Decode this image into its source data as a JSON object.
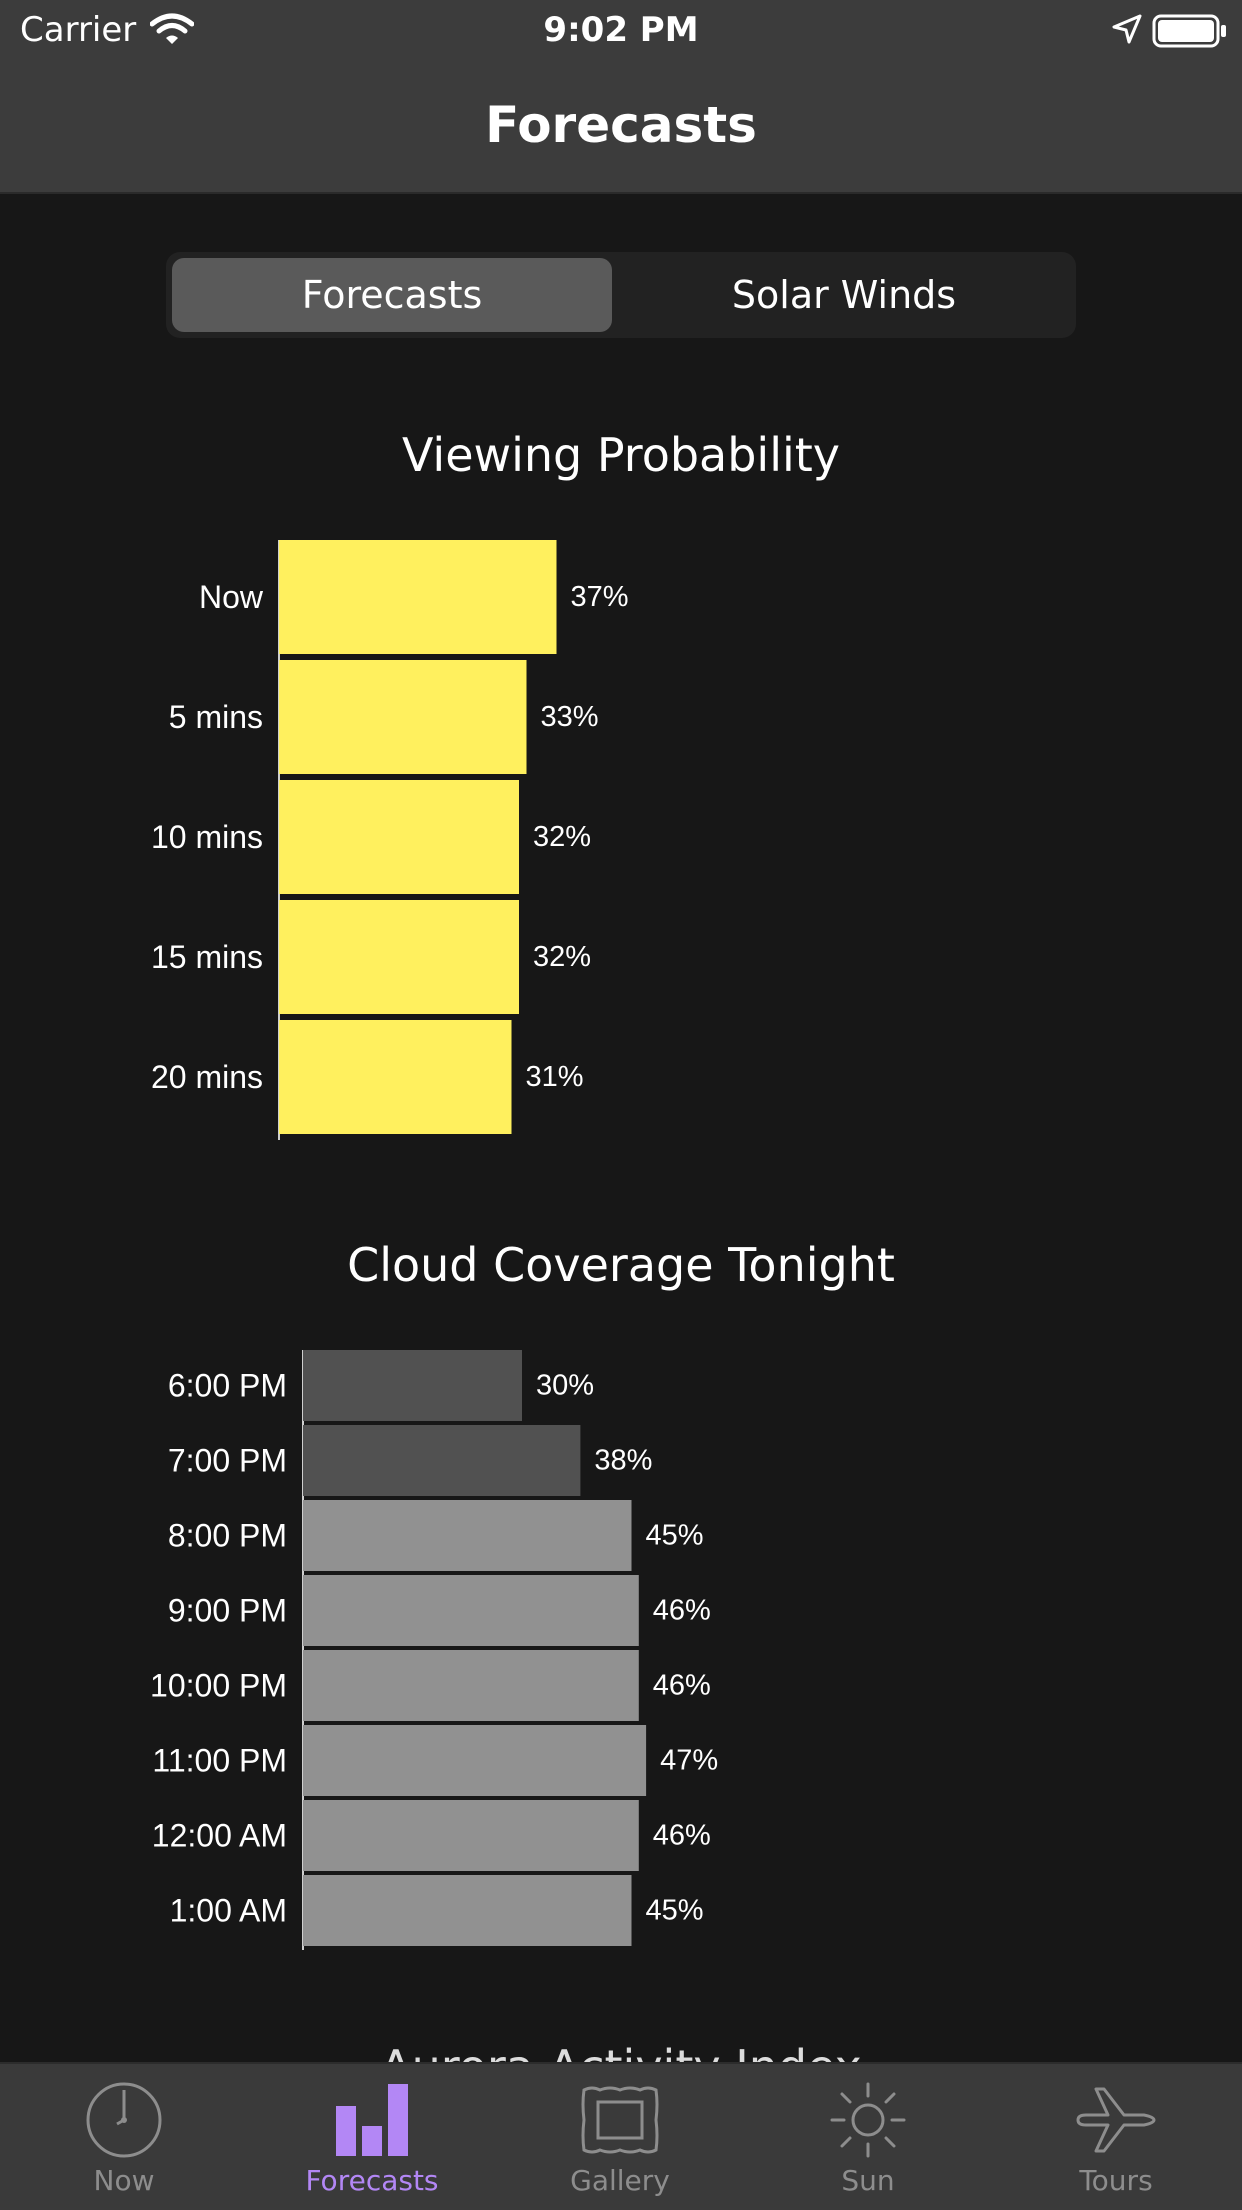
{
  "status_bar": {
    "carrier": "Carrier",
    "time": "9:02 PM"
  },
  "nav": {
    "title": "Forecasts"
  },
  "segmented": {
    "options": [
      "Forecasts",
      "Solar Winds"
    ],
    "selected": "Forecasts"
  },
  "viewing_title": "Viewing Probability",
  "cloud_title": "Cloud Coverage Tonight",
  "next_section_title": "Aurora Activity Index",
  "colors": {
    "viewing_bar": "#fff05e",
    "cloud_bar_dark": "#515151",
    "cloud_bar_light": "#919191",
    "tab_active": "#b387f5",
    "tab_inactive": "#8d8d8d"
  },
  "chart_data": [
    {
      "type": "bar",
      "title": "Viewing Probability",
      "orientation": "horizontal",
      "categories": [
        "Now",
        "5 mins",
        "10 mins",
        "15 mins",
        "20 mins"
      ],
      "values": [
        37,
        33,
        32,
        32,
        31
      ],
      "value_labels": [
        "37%",
        "33%",
        "32%",
        "32%",
        "31%"
      ],
      "unit": "%"
    },
    {
      "type": "bar",
      "title": "Cloud Coverage Tonight",
      "orientation": "horizontal",
      "categories": [
        "6:00 PM",
        "7:00 PM",
        "8:00 PM",
        "9:00 PM",
        "10:00 PM",
        "11:00 PM",
        "12:00 AM",
        "1:00 AM"
      ],
      "values": [
        30,
        38,
        45,
        46,
        46,
        47,
        46,
        45
      ],
      "value_labels": [
        "30%",
        "38%",
        "45%",
        "46%",
        "46%",
        "47%",
        "46%",
        "45%"
      ],
      "unit": "%"
    }
  ],
  "tabs": [
    {
      "label": "Now",
      "icon": "clock-icon"
    },
    {
      "label": "Forecasts",
      "icon": "bar-chart-icon",
      "active": true
    },
    {
      "label": "Gallery",
      "icon": "picture-frame-icon"
    },
    {
      "label": "Sun",
      "icon": "sun-icon"
    },
    {
      "label": "Tours",
      "icon": "airplane-icon"
    }
  ]
}
